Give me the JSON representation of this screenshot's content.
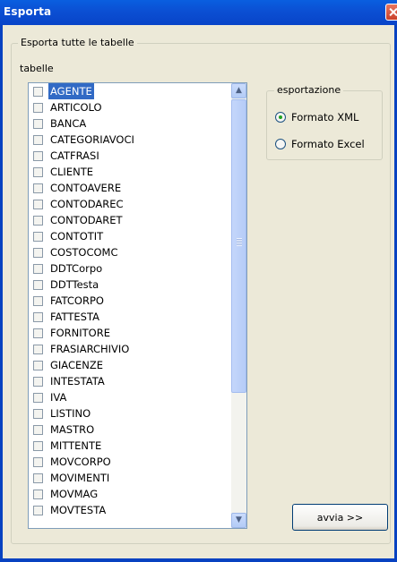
{
  "window": {
    "title": "Esporta"
  },
  "main_group": {
    "label": "Esporta tutte le tabelle"
  },
  "tables": {
    "label": "tabelle",
    "items": [
      {
        "label": "AGENTE",
        "selected": true
      },
      {
        "label": "ARTICOLO"
      },
      {
        "label": "BANCA"
      },
      {
        "label": "CATEGORIAVOCI"
      },
      {
        "label": "CATFRASI"
      },
      {
        "label": "CLIENTE"
      },
      {
        "label": "CONTOAVERE"
      },
      {
        "label": "CONTODAREC"
      },
      {
        "label": "CONTODARET"
      },
      {
        "label": "CONTOTIT"
      },
      {
        "label": "COSTOCOMC"
      },
      {
        "label": "DDTCorpo"
      },
      {
        "label": "DDTTesta"
      },
      {
        "label": "FATCORPO"
      },
      {
        "label": "FATTESTA"
      },
      {
        "label": "FORNITORE"
      },
      {
        "label": "FRASIARCHIVIO"
      },
      {
        "label": "GIACENZE"
      },
      {
        "label": "INTESTATA"
      },
      {
        "label": "IVA"
      },
      {
        "label": "LISTINO"
      },
      {
        "label": "MASTRO"
      },
      {
        "label": "MITTENTE"
      },
      {
        "label": "MOVCORPO"
      },
      {
        "label": "MOVIMENTI"
      },
      {
        "label": "MOVMAG"
      },
      {
        "label": "MOVTESTA"
      }
    ]
  },
  "export_group": {
    "label": "esportazione",
    "options": [
      {
        "label": "Formato XML",
        "checked": true
      },
      {
        "label": "Formato Excel",
        "checked": false
      }
    ]
  },
  "run_button": {
    "label": "avvia >>"
  }
}
